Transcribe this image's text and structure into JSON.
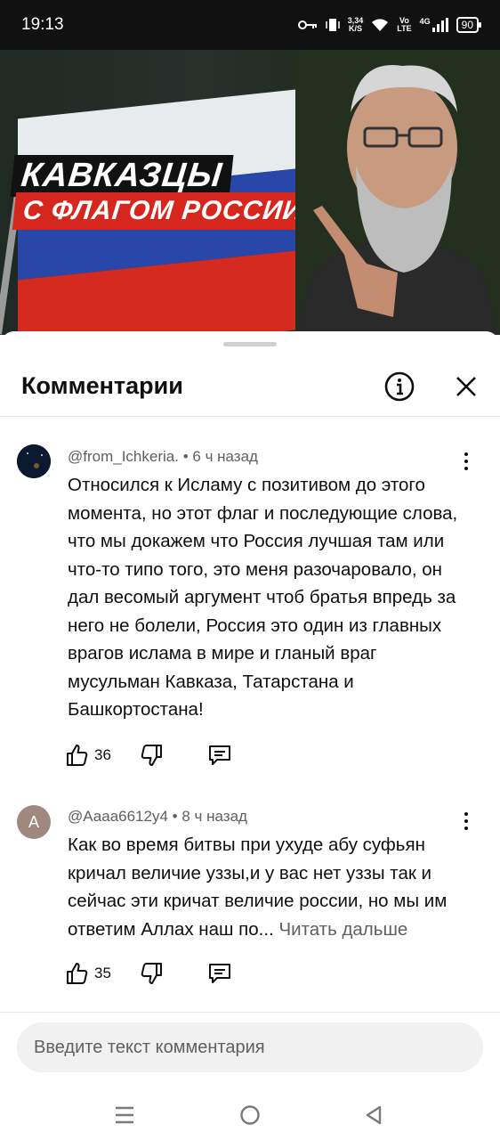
{
  "status_bar": {
    "time": "19:13",
    "net_speed_value": "3,34",
    "net_speed_unit": "K/S",
    "volte_top": "Vo",
    "volte_bottom": "LTE",
    "network": "4G",
    "battery": "90"
  },
  "video": {
    "caption_line1": "КАВКАЗЦЫ",
    "caption_line2": "С ФЛАГОМ РОССИИ"
  },
  "comments_panel": {
    "title": "Комментарии",
    "info_icon": "info-icon",
    "close_icon": "close-icon"
  },
  "comments": [
    {
      "author": "@from_Ichkeria.",
      "time": "6 ч назад",
      "text": "Относился к Исламу с позитивом до этого момента, но этот флаг и последующие слова, что мы докажем что Россия лучшая там или что-то типо того, это меня разочаровало, он дал весомый аргумент чтоб братья впредь за него не болели, Россия это один из главных врагов ислама в мире и гланый враг мусульман Кавказа, Татарстана и Башкортостана!",
      "likes": "36",
      "avatar_letter": ""
    },
    {
      "author": "@Аааа6612у4",
      "time": "8 ч назад",
      "text": "Как во время битвы при ухуде абу суфьян кричал величие уззы,и у вас нет уззы так и сейчас эти кричат величие россии, но мы им ответим Аллах наш по...",
      "read_more": "Читать дальше",
      "likes": "35",
      "avatar_letter": "A"
    }
  ],
  "input": {
    "placeholder": "Введите текст комментария"
  },
  "colors": {
    "accent_text": "#0f0f0f",
    "secondary_text": "#606060",
    "avatar_a": "#a1887f"
  }
}
